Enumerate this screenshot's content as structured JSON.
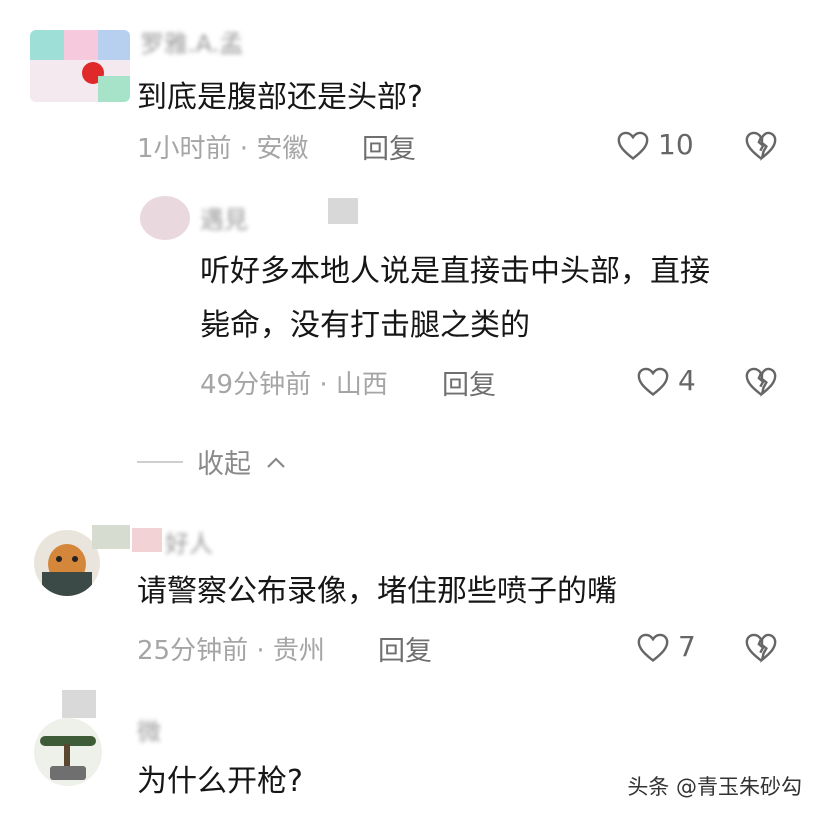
{
  "comments": [
    {
      "username": "罗雅.A.孟",
      "text": "到底是腹部还是头部?",
      "time_location": "1小时前 · 安徽",
      "reply_label": "回复",
      "likes": "10",
      "replies": [
        {
          "username": "遇見",
          "text_lines": [
            "听好多本地人说是直接击中头部，直接",
            "毙命，没有打击腿之类的"
          ],
          "time_location": "49分钟前 · 山西",
          "reply_label": "回复",
          "likes": "4"
        }
      ],
      "collapse_label": "收起"
    },
    {
      "username": "好人",
      "text": "请警察公布录像，堵住那些喷子的嘴",
      "time_location": "25分钟前 · 贵州",
      "reply_label": "回复",
      "likes": "7"
    },
    {
      "username": "微",
      "text": "为什么开枪?"
    }
  ],
  "watermark": "头条 @青玉朱砂勾",
  "colors": {
    "text": "#161616",
    "meta": "#a5a5a5",
    "icon": "#666666"
  }
}
